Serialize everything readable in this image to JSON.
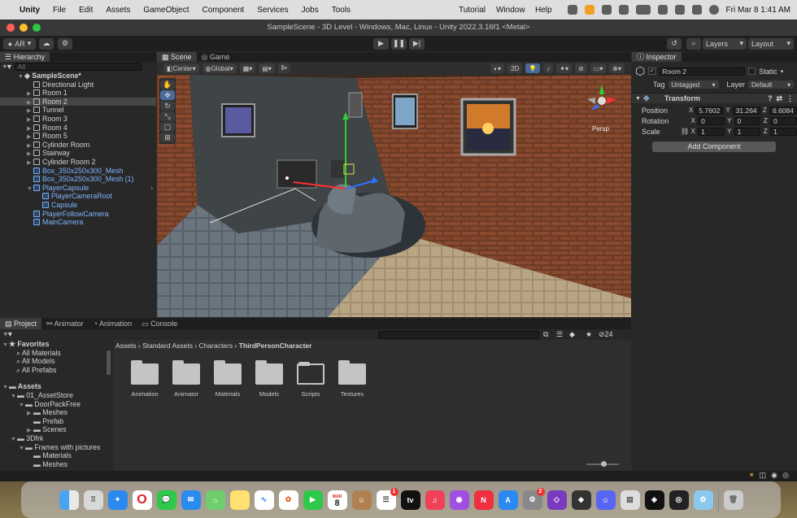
{
  "menubar": {
    "apple": "",
    "app": "Unity",
    "items": [
      "File",
      "Edit",
      "Assets",
      "GameObject",
      "Component",
      "Services",
      "Jobs",
      "Tools"
    ],
    "right_items": [
      "Tutorial",
      "Window",
      "Help"
    ],
    "datetime": "Fri Mar 8  1:41 AM"
  },
  "window": {
    "title": "SampleScene - 3D Level - Windows, Mac, Linux - Unity 2022.3.16f1 <Metal>"
  },
  "toolbar": {
    "account": "AR",
    "layers": "Layers",
    "layout": "Layout"
  },
  "hierarchy": {
    "tab": "Hierarchy",
    "search_placeholder": "All",
    "scene": "SampleScene*",
    "items": [
      {
        "label": "Directional Light",
        "indent": 2,
        "blue": false,
        "arrow": false
      },
      {
        "label": "Room 1",
        "indent": 2,
        "blue": false,
        "arrow": true
      },
      {
        "label": "Room 2",
        "indent": 2,
        "blue": false,
        "arrow": true,
        "selected": true
      },
      {
        "label": "Tunnel",
        "indent": 2,
        "blue": false,
        "arrow": true
      },
      {
        "label": "Room 3",
        "indent": 2,
        "blue": false,
        "arrow": true
      },
      {
        "label": "Room 4",
        "indent": 2,
        "blue": false,
        "arrow": true
      },
      {
        "label": "Room 5",
        "indent": 2,
        "blue": false,
        "arrow": true
      },
      {
        "label": "Cylinder Room",
        "indent": 2,
        "blue": false,
        "arrow": true
      },
      {
        "label": "Stairway",
        "indent": 2,
        "blue": false,
        "arrow": true
      },
      {
        "label": "Cylinder Room 2",
        "indent": 2,
        "blue": false,
        "arrow": true
      },
      {
        "label": "Box_350x250x300_Mesh",
        "indent": 2,
        "blue": true,
        "arrow": false
      },
      {
        "label": "Box_350x250x300_Mesh (1)",
        "indent": 2,
        "blue": true,
        "arrow": false
      },
      {
        "label": "PlayerCapsule",
        "indent": 2,
        "blue": true,
        "arrow": true,
        "open": true
      },
      {
        "label": "PlayerCameraRoot",
        "indent": 3,
        "blue": true,
        "arrow": false
      },
      {
        "label": "Capsule",
        "indent": 3,
        "blue": true,
        "arrow": false
      },
      {
        "label": "PlayerFollowCamera",
        "indent": 2,
        "blue": true,
        "arrow": false
      },
      {
        "label": "MainCamera",
        "indent": 2,
        "blue": true,
        "arrow": false
      }
    ]
  },
  "scene": {
    "tabs": [
      "Scene",
      "Game"
    ],
    "pivot": "Center",
    "space": "Global",
    "mode_2d": "2D",
    "persp": "Persp"
  },
  "inspector": {
    "tab": "Inspector",
    "object_name": "Room 2",
    "static": "Static",
    "tag_label": "Tag",
    "tag": "Untagged",
    "layer_label": "Layer",
    "layer": "Default",
    "component": "Transform",
    "position": {
      "label": "Position",
      "x": "5.7602",
      "y": "31.264",
      "z": "6.6084"
    },
    "rotation": {
      "label": "Rotation",
      "x": "0",
      "y": "0",
      "z": "0"
    },
    "scale": {
      "label": "Scale",
      "x": "1",
      "y": "1",
      "z": "1"
    },
    "add_component": "Add Component"
  },
  "project": {
    "tabs": [
      "Project",
      "Animator",
      "Animation",
      "Console"
    ],
    "count": "24",
    "favorites": {
      "label": "Favorites",
      "items": [
        "All Materials",
        "All Models",
        "All Prefabs"
      ]
    },
    "tree": [
      {
        "label": "Assets",
        "indent": 0,
        "arrow": true
      },
      {
        "label": "01_AssetStore",
        "indent": 1,
        "arrow": true
      },
      {
        "label": "DoorPackFree",
        "indent": 2,
        "arrow": true
      },
      {
        "label": "Meshes",
        "indent": 3,
        "arrow": true
      },
      {
        "label": "Prefab",
        "indent": 3,
        "arrow": false
      },
      {
        "label": "Scenes",
        "indent": 3,
        "arrow": true
      },
      {
        "label": "3Dfrk",
        "indent": 1,
        "arrow": true
      },
      {
        "label": "Frames with pictures",
        "indent": 2,
        "arrow": true
      },
      {
        "label": "Materials",
        "indent": 3,
        "arrow": false
      },
      {
        "label": "Meshes",
        "indent": 3,
        "arrow": false
      }
    ],
    "breadcrumb": [
      "Assets",
      "Standard Assets",
      "Characters",
      "ThirdPersonCharacter"
    ],
    "folders": [
      "Animation",
      "Animator",
      "Materials",
      "Models",
      "Scripts",
      "Textures"
    ]
  },
  "dock": {
    "calendar_month": "MAR",
    "calendar_day": "8",
    "badge": "1",
    "badge2": "2"
  }
}
